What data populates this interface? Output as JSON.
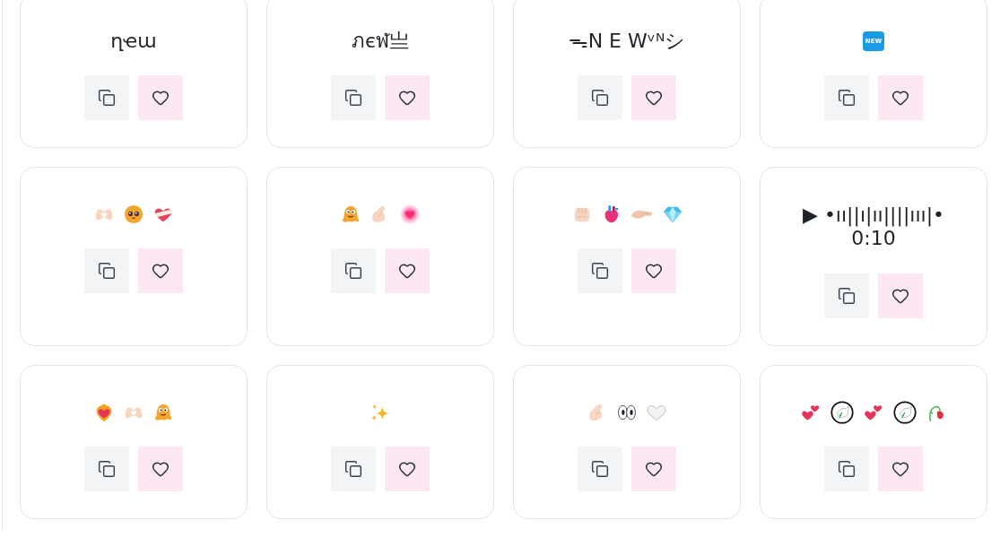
{
  "cards": [
    {
      "kind": "text",
      "lines": [
        "ղҽա"
      ]
    },
    {
      "kind": "text",
      "lines": [
        "ภєฬ亗"
      ]
    },
    {
      "kind": "text",
      "lines": [
        "ᯓN E Wᵛᴺシ"
      ]
    },
    {
      "kind": "badge",
      "text": "NEW"
    },
    {
      "kind": "emoji",
      "symbols": [
        {
          "kind": "hearthands"
        },
        {
          "kind": "pleading"
        },
        {
          "kind": "mendingheart"
        }
      ]
    },
    {
      "kind": "emoji",
      "symbols": [
        {
          "kind": "melting"
        },
        {
          "kind": "pinch"
        },
        {
          "kind": "glowingheart"
        }
      ]
    },
    {
      "kind": "emoji",
      "symbols": [
        {
          "kind": "fist"
        },
        {
          "kind": "anatomicalheart"
        },
        {
          "kind": "palmup"
        },
        {
          "kind": "gem"
        }
      ]
    },
    {
      "kind": "text",
      "lines": [
        "▶ •ıı||ı|ıı||||ııı|•",
        "0:10"
      ]
    },
    {
      "kind": "emoji",
      "symbols": [
        {
          "kind": "fireheart"
        },
        {
          "kind": "hearthands"
        },
        {
          "kind": "melting"
        }
      ]
    },
    {
      "kind": "emoji",
      "symbols": [
        {
          "kind": "sparkles"
        }
      ]
    },
    {
      "kind": "emoji",
      "symbols": [
        {
          "kind": "pinch"
        },
        {
          "kind": "eyes"
        },
        {
          "kind": "whiteheart"
        }
      ]
    },
    {
      "kind": "emoji",
      "symbols": [
        {
          "kind": "twohearts"
        },
        {
          "kind": "dove"
        },
        {
          "kind": "twohearts"
        },
        {
          "kind": "dove"
        },
        {
          "kind": "wiltedrose"
        }
      ]
    }
  ]
}
